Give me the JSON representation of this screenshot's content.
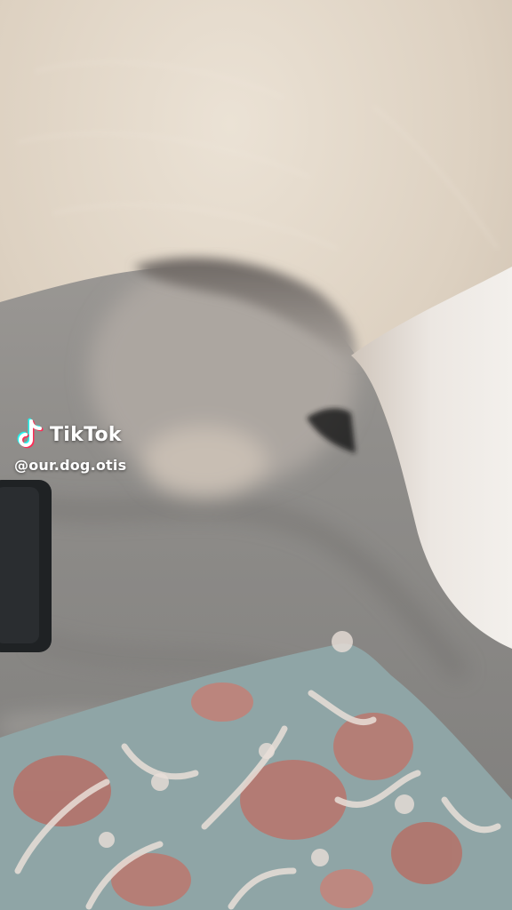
{
  "watermark": {
    "brand": "TikTok",
    "handle": "@our.dog.otis",
    "logo_icon": "tiktok-note-icon"
  },
  "colors": {
    "fur": "#e8ddcf",
    "couch": "#8f8e8c",
    "pillow_base": "#8fa6a6",
    "pillow_pattern": "#b8766e"
  }
}
